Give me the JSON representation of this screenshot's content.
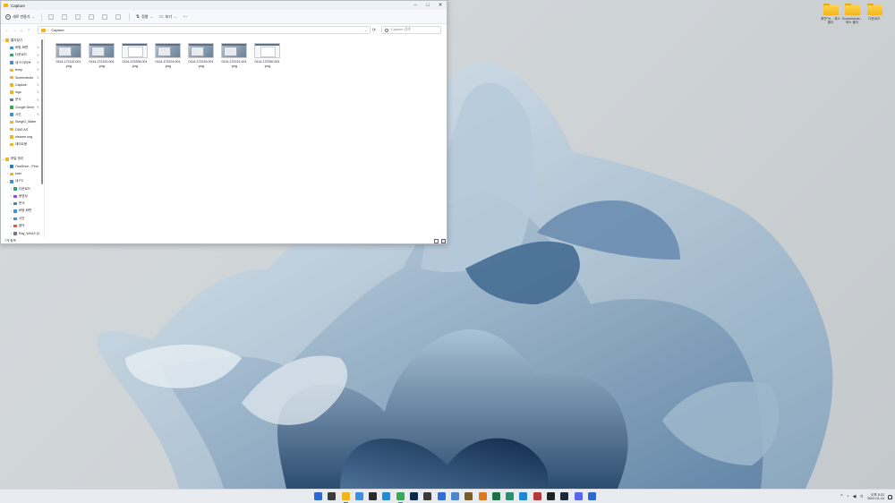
{
  "window": {
    "title": "Capture",
    "controls": {
      "minimize": "–",
      "maximize": "□",
      "close": "✕"
    }
  },
  "commandbar": {
    "new_label": "새로 만들기",
    "new_caret": "⌄",
    "sort_label": "정렬",
    "sort_caret": "⌄",
    "view_label": "보기",
    "view_caret": "⌄",
    "more_label": "···"
  },
  "addressbar": {
    "back": "←",
    "forward": "→",
    "recent": "⌄",
    "up": "↑",
    "separator": "›",
    "path": "Capture",
    "dropdown": "⌄",
    "refresh": "⟳",
    "search_placeholder": "Capture 검색"
  },
  "navpane": {
    "items": [
      {
        "label": "즐겨찾기",
        "chevron": "⌄",
        "color": "#f2b41c",
        "indent": 0,
        "pinned": false
      },
      {
        "label": "바탕 화면",
        "chevron": "",
        "color": "#3f8ee0",
        "indent": 1,
        "pinned": true
      },
      {
        "label": "다운로드",
        "chevron": "",
        "color": "#2fa36b",
        "indent": 1,
        "pinned": true
      },
      {
        "label": "내 드라이브",
        "chevron": "",
        "color": "#4a86e8",
        "indent": 1,
        "pinned": true
      },
      {
        "label": "temp",
        "chevron": "",
        "color": "#f2b41c",
        "indent": 1,
        "pinned": true
      },
      {
        "label": "Screenshots",
        "chevron": "",
        "color": "#f2b41c",
        "indent": 1,
        "pinned": true
      },
      {
        "label": "Capture",
        "chevron": "",
        "color": "#f2b41c",
        "indent": 1,
        "pinned": true
      },
      {
        "label": "logo",
        "chevron": "",
        "color": "#f2b41c",
        "indent": 1,
        "pinned": true
      },
      {
        "label": "문서",
        "chevron": "",
        "color": "#6b7a8f",
        "indent": 1,
        "pinned": true
      },
      {
        "label": "Google Drive",
        "chevron": "",
        "color": "#3aa757",
        "indent": 1,
        "pinned": true
      },
      {
        "label": "사진",
        "chevron": "",
        "color": "#3f8ee0",
        "indent": 1,
        "pinned": true
      },
      {
        "label": "SungIG_Mater",
        "chevron": "",
        "color": "#f2b41c",
        "indent": 1,
        "pinned": false
      },
      {
        "label": "DIAS AS",
        "chevron": "",
        "color": "#f2b41c",
        "indent": 1,
        "pinned": false
      },
      {
        "label": "elearne.ong",
        "chevron": "",
        "color": "#f2b41c",
        "indent": 1,
        "pinned": false
      },
      {
        "label": "데이트용",
        "chevron": "",
        "color": "#f2b41c",
        "indent": 1,
        "pinned": false
      },
      {
        "label": "",
        "chevron": "",
        "color": "",
        "indent": 1,
        "pinned": false
      },
      {
        "label": "파일 정리",
        "chevron": "⌄",
        "color": "#f2b41c",
        "indent": 0,
        "pinned": false
      },
      {
        "label": "OneDrive - Pers",
        "chevron": "›",
        "color": "#2b7cd3",
        "indent": 1,
        "pinned": false
      },
      {
        "label": "user",
        "chevron": "›",
        "color": "#f2b41c",
        "indent": 1,
        "pinned": false
      },
      {
        "label": "내 PC",
        "chevron": "⌄",
        "color": "#3f8ee0",
        "indent": 1,
        "pinned": false
      },
      {
        "label": "다운로드",
        "chevron": "›",
        "color": "#2fa36b",
        "indent": 2,
        "pinned": false
      },
      {
        "label": "동영상",
        "chevron": "›",
        "color": "#8a4fd6",
        "indent": 2,
        "pinned": false
      },
      {
        "label": "문서",
        "chevron": "›",
        "color": "#6b7a8f",
        "indent": 2,
        "pinned": false
      },
      {
        "label": "바탕 화면",
        "chevron": "›",
        "color": "#3f8ee0",
        "indent": 2,
        "pinned": false
      },
      {
        "label": "사진",
        "chevron": "›",
        "color": "#3f8ee0",
        "indent": 2,
        "pinned": false
      },
      {
        "label": "음악",
        "chevron": "›",
        "color": "#e0562f",
        "indent": 2,
        "pinned": false
      },
      {
        "label": "Ray_Win10 (C:",
        "chevron": "›",
        "color": "#6b7a8f",
        "indent": 2,
        "pinned": false
      },
      {
        "label": "",
        "chevron": "›",
        "color": "#6b7a8f",
        "indent": 2,
        "pinned": false
      }
    ]
  },
  "files": [
    {
      "name": "0114-172112-001",
      "ext": ".png",
      "style": "rich"
    },
    {
      "name": "0114-172120-001",
      "ext": ".png",
      "style": "rich"
    },
    {
      "name": "0114-172208-001",
      "ext": ".png",
      "style": "light"
    },
    {
      "name": "0114-172224-001",
      "ext": ".png",
      "style": "rich"
    },
    {
      "name": "0114-172229-001",
      "ext": ".png",
      "style": "rich"
    },
    {
      "name": "0114-172231-001",
      "ext": ".png",
      "style": "rich"
    },
    {
      "name": "0114-172330-001",
      "ext": ".png",
      "style": "light"
    }
  ],
  "statusbar": {
    "count": "7개 항목"
  },
  "desktop": {
    "icons": [
      {
        "label": "화면 녹... 제스 폴더"
      },
      {
        "label": "Screenshots - 제스 폴더"
      },
      {
        "label": "다운로드"
      }
    ]
  },
  "taskbar": {
    "apps": [
      {
        "name": "start",
        "color": "#2b6bd1",
        "running": false
      },
      {
        "name": "search",
        "color": "#3c3c3c",
        "running": false
      },
      {
        "name": "file-explorer",
        "color": "#f2b41c",
        "running": true
      },
      {
        "name": "widgets",
        "color": "#3f8ee0",
        "running": false
      },
      {
        "name": "store",
        "color": "#2b2b2b",
        "running": false
      },
      {
        "name": "edge",
        "color": "#1f8bd6",
        "running": false
      },
      {
        "name": "chrome",
        "color": "#3aa757",
        "running": true
      },
      {
        "name": "photoshop",
        "color": "#0d2a4d",
        "running": false
      },
      {
        "name": "terminal",
        "color": "#3b3b3b",
        "running": false
      },
      {
        "name": "app-blue",
        "color": "#2f6ed4",
        "running": false
      },
      {
        "name": "refresh-app",
        "color": "#4f86c9",
        "running": false
      },
      {
        "name": "app-brown",
        "color": "#7a5b2a",
        "running": false
      },
      {
        "name": "app-orange",
        "color": "#d97a1c",
        "running": false
      },
      {
        "name": "excel",
        "color": "#1e7145",
        "running": false
      },
      {
        "name": "app-teal",
        "color": "#2b8f6e",
        "running": false
      },
      {
        "name": "app-azure",
        "color": "#1f86d1",
        "running": false
      },
      {
        "name": "app-red",
        "color": "#b23a3a",
        "running": false
      },
      {
        "name": "app-dark",
        "color": "#222222",
        "running": false
      },
      {
        "name": "app-steam",
        "color": "#1b2838",
        "running": false
      },
      {
        "name": "discord",
        "color": "#5865f2",
        "running": false
      },
      {
        "name": "app-calendar",
        "color": "#2b6bd1",
        "running": false
      }
    ],
    "tray": {
      "chevron": "^",
      "wifi": "◔",
      "volume": "◀",
      "lang": "가",
      "time": "오후 5:22",
      "date": "2022-01-14"
    }
  },
  "colors": {
    "accent": "#2b6bd1",
    "wallpaper_light": "#d6dadd",
    "wallpaper_dark": "#1d3a5c"
  }
}
